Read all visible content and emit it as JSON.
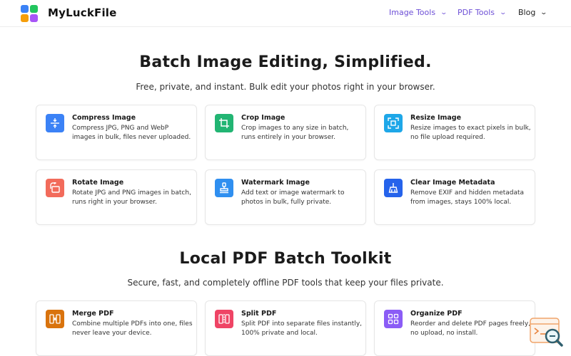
{
  "header": {
    "brand": "MyLuckFile",
    "nav": [
      {
        "label": "Image Tools"
      },
      {
        "label": "PDF Tools"
      },
      {
        "label": "Blog"
      }
    ]
  },
  "image_section": {
    "title": "Batch Image Editing, Simplified.",
    "subtitle": "Free, private, and instant. Bulk edit your photos right in your browser.",
    "cards": [
      {
        "title": "Compress Image",
        "desc": "Compress JPG, PNG and WebP images in bulk, files never uploaded.",
        "icon": "compress-icon",
        "color": "#3b82f6"
      },
      {
        "title": "Crop Image",
        "desc": "Crop images to any size in batch, runs entirely in your browser.",
        "icon": "crop-icon",
        "color": "#22b573"
      },
      {
        "title": "Resize Image",
        "desc": "Resize images to exact pixels in bulk, no file upload required.",
        "icon": "resize-icon",
        "color": "#1ea7e8"
      },
      {
        "title": "Rotate Image",
        "desc": "Rotate JPG and PNG images in batch, runs right in your browser.",
        "icon": "rotate-icon",
        "color": "#f26b5b"
      },
      {
        "title": "Watermark Image",
        "desc": "Add text or image watermark to photos in bulk, fully private.",
        "icon": "stamp-icon",
        "color": "#2f8ff0"
      },
      {
        "title": "Clear Image Metadata",
        "desc": "Remove EXIF and hidden metadata from images, stays 100% local.",
        "icon": "broom-icon",
        "color": "#2563eb"
      }
    ]
  },
  "pdf_section": {
    "title": "Local PDF Batch Toolkit",
    "subtitle": "Secure, fast, and completely offline PDF tools that keep your files private.",
    "cards": [
      {
        "title": "Merge PDF",
        "desc": "Combine multiple PDFs into one, files never leave your device.",
        "icon": "merge-icon",
        "color": "#d9730d"
      },
      {
        "title": "Split PDF",
        "desc": "Split PDF into separate files instantly, 100% private and local.",
        "icon": "split-icon",
        "color": "#ef4465"
      },
      {
        "title": "Organize PDF",
        "desc": "Reorder and delete PDF pages freely, no upload, no install.",
        "icon": "grid-icon",
        "color": "#8b5cf6"
      }
    ]
  }
}
